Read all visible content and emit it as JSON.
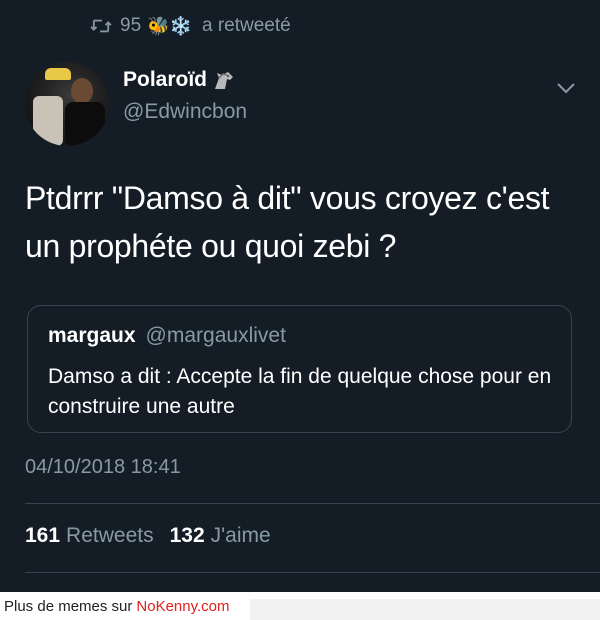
{
  "retweet": {
    "count": "95",
    "emojis": "🐝❄️",
    "label": "a retweeté"
  },
  "author": {
    "name": "Polaroïd",
    "handle": "@Edwincbon"
  },
  "tweet": {
    "text": "Ptdrrr \"Damso à dit\" vous croyez c'est un prophéte ou quoi zebi ?"
  },
  "quoted": {
    "name": "margaux",
    "handle": "@margauxlivet",
    "text": "Damso a dit : Accepte la fin de quelque chose pour en construire une autre"
  },
  "timestamp": "04/10/2018 18:41",
  "stats": {
    "retweets_count": "161",
    "retweets_label": "Retweets",
    "likes_count": "132",
    "likes_label": "J'aime"
  },
  "footer": {
    "prefix": "Plus de memes sur",
    "link": "NoKenny.com"
  },
  "colors": {
    "background": "#141d26",
    "secondary_text": "#8899a6",
    "border": "#38444d",
    "footer_link": "#e0201b"
  }
}
